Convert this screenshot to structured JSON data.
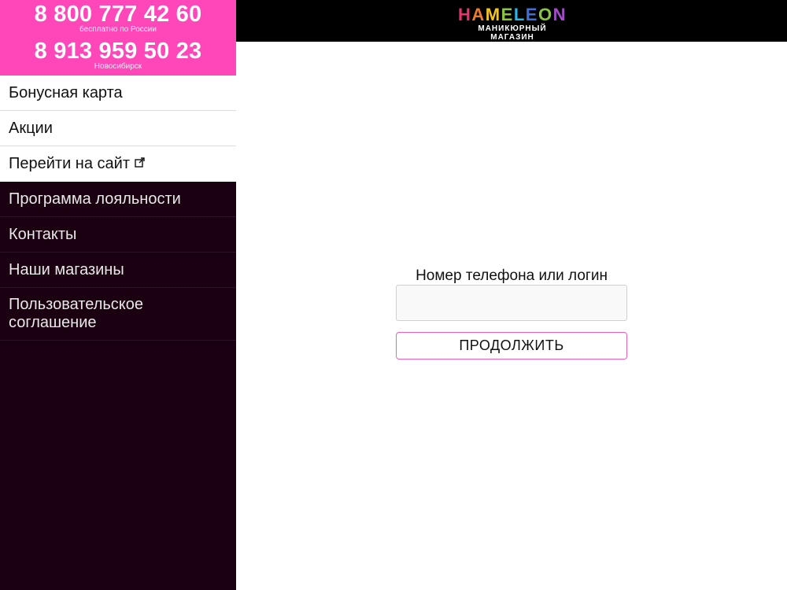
{
  "phones": [
    {
      "number": "8 800 777 42 60",
      "note": "бесплатно по России"
    },
    {
      "number": "8 913 959 50 23",
      "note": "Новосибирск"
    }
  ],
  "nav_light": [
    {
      "label": "Бонусная карта"
    },
    {
      "label": "Акции"
    },
    {
      "label": "Перейти на сайт",
      "icon": "external-link-icon"
    }
  ],
  "nav_dark": [
    {
      "label": "Программа лояльности"
    },
    {
      "label": "Контакты"
    },
    {
      "label": "Наши магазины"
    },
    {
      "label": "Пользовательское соглашение"
    }
  ],
  "logo": {
    "letters": [
      "H",
      "A",
      "M",
      "E",
      "L",
      "E",
      "O",
      "N"
    ],
    "letter_colors": [
      "#e8336f",
      "#f07b2a",
      "#f5c518",
      "#8bc53f",
      "#2eb3e6",
      "#3f6fd8",
      "#8bc53f",
      "#a44cc7"
    ],
    "subtitle": "МАНИКЮРНЫЙ МАГАЗИН"
  },
  "login": {
    "label": "Номер телефона или логин",
    "input_value": "",
    "input_placeholder": "",
    "button_label": "ПРОДОЛЖИТЬ"
  },
  "colors": {
    "brand_pink": "#ff47ba",
    "sidebar_dark": "#1a0010",
    "button_border": "#f060b8"
  }
}
